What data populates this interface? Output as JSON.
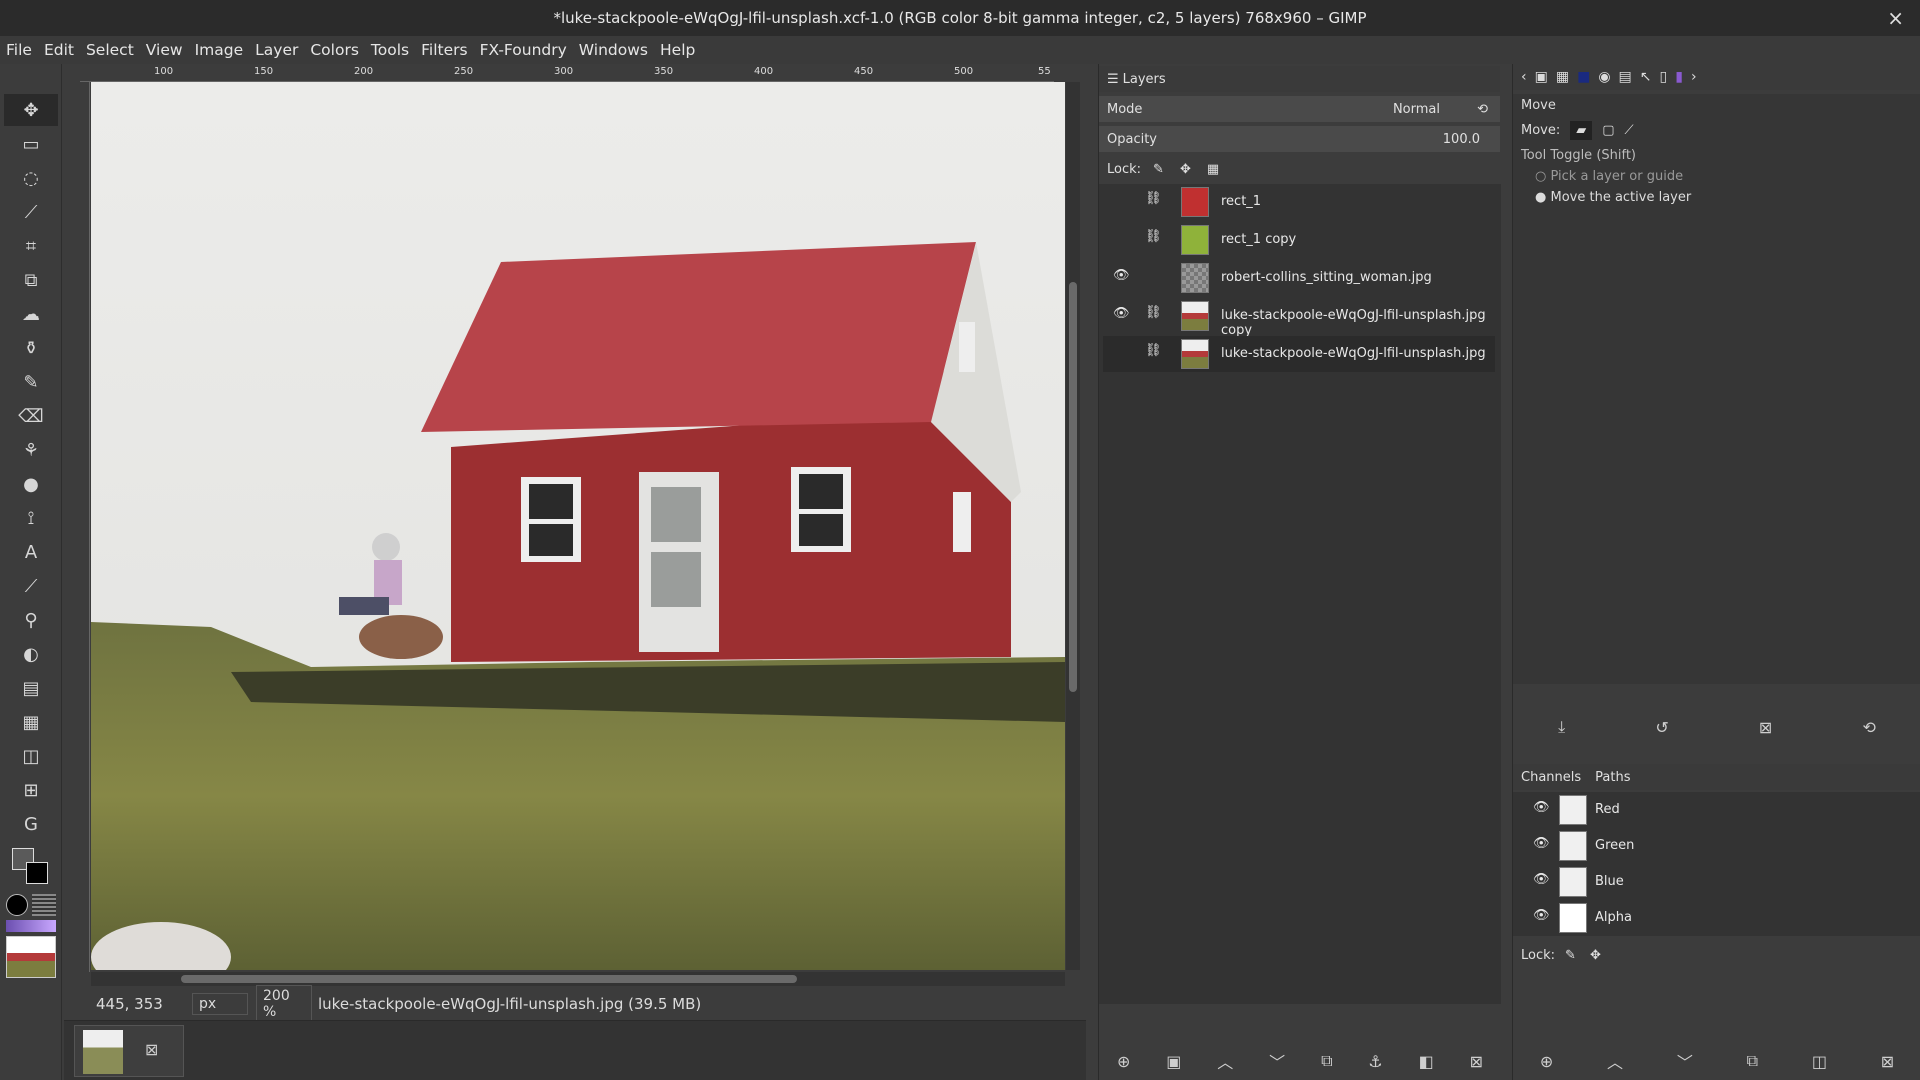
{
  "window": {
    "title": "*luke-stackpoole-eWqOgJ-lfil-unsplash.xcf-1.0 (RGB color 8-bit gamma integer, c2, 5 layers) 768x960 – GIMP",
    "close": "×"
  },
  "menu": [
    "File",
    "Edit",
    "Select",
    "View",
    "Image",
    "Layer",
    "Colors",
    "Tools",
    "Filters",
    "FX-Foundry",
    "Windows",
    "Help"
  ],
  "ruler": {
    "labels": [
      "100",
      "150",
      "200",
      "250",
      "300",
      "350",
      "400",
      "450",
      "500",
      "55"
    ]
  },
  "status": {
    "coords": "445, 353",
    "unit": "px",
    "zoom": "200 %",
    "file": "luke-stackpoole-eWqOgJ-lfil-unsplash.jpg (39.5 MB)"
  },
  "layers_panel": {
    "tab": "Layers",
    "mode_label": "Mode",
    "mode_value": "Normal",
    "opacity_label": "Opacity",
    "opacity_value": "100.0",
    "lock_label": "Lock:",
    "layers": [
      {
        "name": "rect_1",
        "visible": false,
        "linked": true,
        "thumb": "red"
      },
      {
        "name": "rect_1 copy",
        "visible": false,
        "linked": true,
        "thumb": "green"
      },
      {
        "name": "robert-collins_sitting_woman.jpg",
        "visible": true,
        "linked": false,
        "thumb": "checker"
      },
      {
        "name": "luke-stackpoole-eWqOgJ-lfil-unsplash.jpg copy",
        "visible": true,
        "linked": true,
        "thumb": "photo"
      },
      {
        "name": "luke-stackpoole-eWqOgJ-lfil-unsplash.jpg",
        "visible": false,
        "linked": true,
        "thumb": "photo",
        "selected": true
      }
    ]
  },
  "tool_options": {
    "title": "Move",
    "move_label": "Move:",
    "toggle_label": "Tool Toggle  (Shift)",
    "options": [
      "Pick a layer or guide",
      "Move the active layer"
    ]
  },
  "channels_panel": {
    "tabs": [
      "Channels",
      "Paths"
    ],
    "channels": [
      "Red",
      "Green",
      "Blue",
      "Alpha"
    ],
    "lock_label": "Lock:"
  },
  "colors": {
    "accent_red": "#b43a3a",
    "grass": "#7c7d3f"
  }
}
